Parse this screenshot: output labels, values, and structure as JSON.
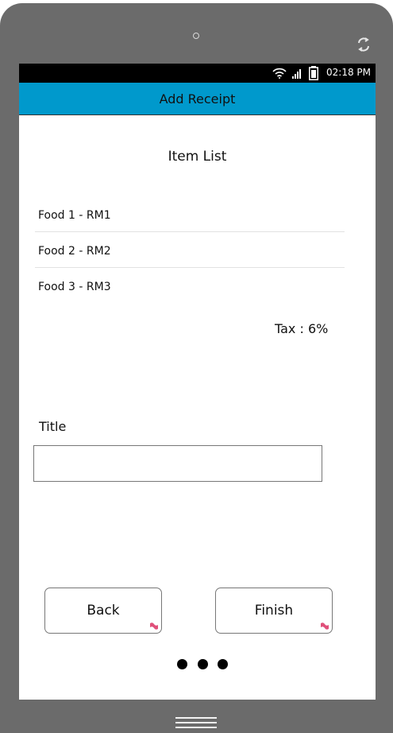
{
  "status_bar": {
    "time": "02:18 PM"
  },
  "header": {
    "title": "Add Receipt"
  },
  "section_title": "Item List",
  "items": [
    {
      "label": "Food 1 - RM1"
    },
    {
      "label": "Food 2 - RM2"
    },
    {
      "label": "Food 3 - RM3"
    }
  ],
  "tax_label": "Tax : 6%",
  "form": {
    "title_label": "Title",
    "title_value": ""
  },
  "buttons": {
    "back_label": "Back",
    "finish_label": "Finish"
  },
  "pager": {
    "dot_count": 3
  },
  "colors": {
    "accent": "#0099cc",
    "frame": "#6b6b6b",
    "status_bar": "#000000"
  },
  "icons": [
    "wifi-icon",
    "signal-icon",
    "battery-icon",
    "rotate-icon",
    "flag-icon",
    "home-icon"
  ]
}
